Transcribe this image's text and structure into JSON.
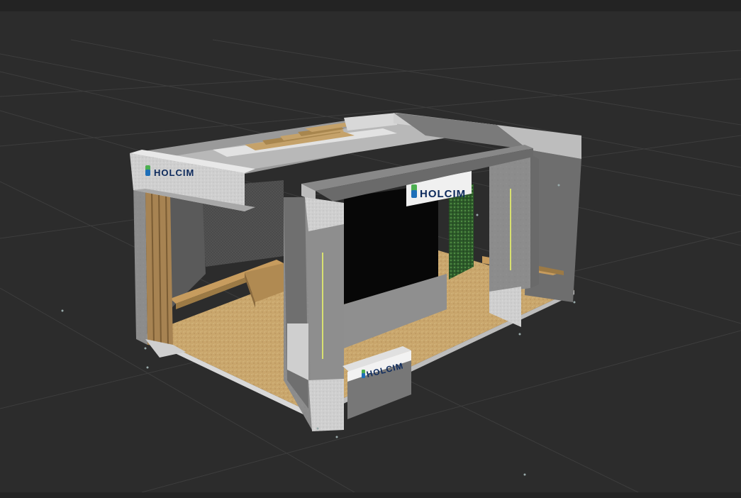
{
  "app": {
    "view": "3d-viewport",
    "grid": true
  },
  "booth": {
    "brand": "HOLCIM",
    "brand_color": "#0d2a5c",
    "logo_colors": {
      "green": "#4caf50",
      "blue": "#1e6fb8"
    },
    "colors": {
      "concrete": "#8a8a8a",
      "concrete_dark": "#6f6f6f",
      "concrete_light": "#b4b4b4",
      "floor": "#c7a56b",
      "wood": "#b99459",
      "screen": "#080808",
      "green_wall": "#2f5f2f",
      "led_strip": "#d8e070"
    }
  }
}
